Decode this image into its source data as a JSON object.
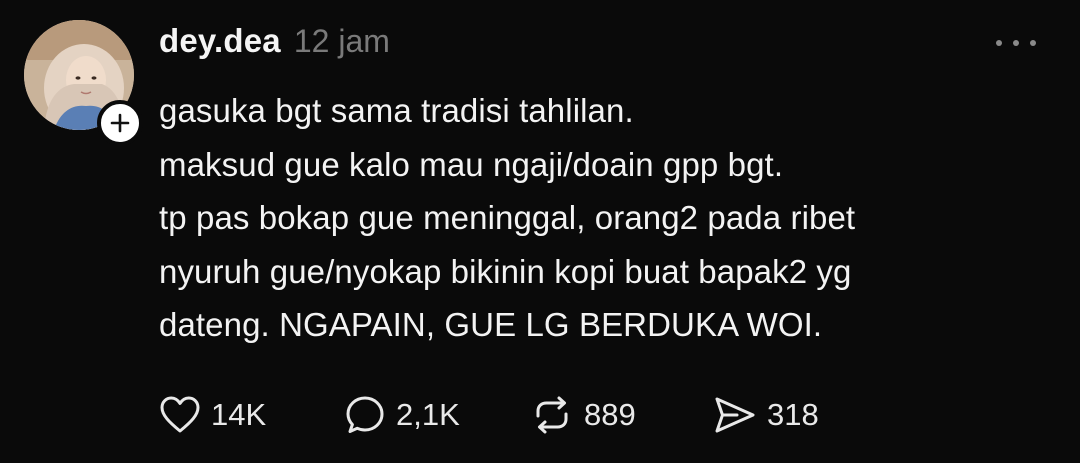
{
  "post": {
    "username": "dey.dea",
    "timestamp": "12 jam",
    "lines": [
      "gasuka bgt sama tradisi tahlilan.",
      "maksud gue kalo mau ngaji/doain gpp bgt.",
      "tp pas bokap gue meninggal, orang2 pada ribet",
      "nyuruh gue/nyokap bikinin kopi buat bapak2 yg",
      "dateng. NGAPAIN, GUE LG BERDUKA WOI."
    ]
  },
  "actions": {
    "likes": "14K",
    "replies": "2,1K",
    "reposts": "889",
    "shares": "318"
  },
  "icons": {
    "like": "heart-icon",
    "reply": "speech-bubble-icon",
    "repost": "repost-icon",
    "share": "send-icon",
    "follow": "plus-icon",
    "more": "more-horizontal-icon"
  },
  "colors": {
    "background": "#0a0a0a",
    "text": "#f3f3f3",
    "muted": "#7a7a7a",
    "follow_badge": "#ffffff"
  }
}
